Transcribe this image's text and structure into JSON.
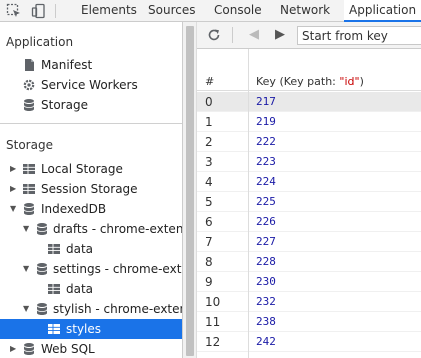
{
  "tabs": [
    "Elements",
    "Sources",
    "Console",
    "Network",
    "Application"
  ],
  "active_tab": "Application",
  "sidebar": {
    "application_title": "Application",
    "application_items": [
      {
        "label": "Manifest",
        "icon": "document-icon"
      },
      {
        "label": "Service Workers",
        "icon": "gear-icon"
      },
      {
        "label": "Storage",
        "icon": "database-icon"
      }
    ],
    "storage_title": "Storage",
    "storage_items": [
      {
        "label": "Local Storage"
      },
      {
        "label": "Session Storage"
      },
      {
        "label": "IndexedDB"
      },
      {
        "label": "drafts - chrome-extension://..."
      },
      {
        "label": "data"
      },
      {
        "label": "settings - chrome-extension://..."
      },
      {
        "label": "data"
      },
      {
        "label": "stylish - chrome-extension://..."
      },
      {
        "label": "styles"
      },
      {
        "label": "Web SQL"
      }
    ]
  },
  "data_view": {
    "search_placeholder": "Start from key",
    "header_num": "#",
    "header_key_prefix": "Key (Key path: ",
    "header_key_path": "\"id\"",
    "header_key_suffix": ")",
    "rows": [
      {
        "num": "0",
        "key": "217"
      },
      {
        "num": "1",
        "key": "219"
      },
      {
        "num": "2",
        "key": "222"
      },
      {
        "num": "3",
        "key": "223"
      },
      {
        "num": "4",
        "key": "224"
      },
      {
        "num": "5",
        "key": "225"
      },
      {
        "num": "6",
        "key": "226"
      },
      {
        "num": "7",
        "key": "227"
      },
      {
        "num": "8",
        "key": "228"
      },
      {
        "num": "9",
        "key": "230"
      },
      {
        "num": "10",
        "key": "232"
      },
      {
        "num": "11",
        "key": "238"
      },
      {
        "num": "12",
        "key": "242"
      }
    ]
  },
  "colors": {
    "accent": "#1a73e8",
    "key_value": "#1a1aa6",
    "key_path": "#c80000"
  }
}
